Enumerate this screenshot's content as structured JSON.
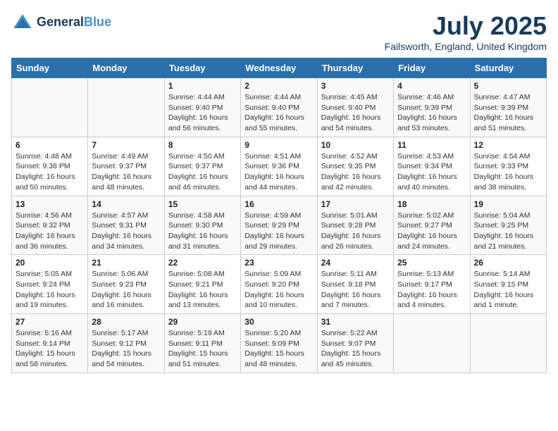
{
  "header": {
    "logo_line1": "General",
    "logo_line2": "Blue",
    "month": "July 2025",
    "location": "Failsworth, England, United Kingdom"
  },
  "days_of_week": [
    "Sunday",
    "Monday",
    "Tuesday",
    "Wednesday",
    "Thursday",
    "Friday",
    "Saturday"
  ],
  "weeks": [
    [
      {
        "day": "",
        "sunrise": "",
        "sunset": "",
        "daylight": ""
      },
      {
        "day": "",
        "sunrise": "",
        "sunset": "",
        "daylight": ""
      },
      {
        "day": "1",
        "sunrise": "Sunrise: 4:44 AM",
        "sunset": "Sunset: 9:40 PM",
        "daylight": "Daylight: 16 hours and 56 minutes."
      },
      {
        "day": "2",
        "sunrise": "Sunrise: 4:44 AM",
        "sunset": "Sunset: 9:40 PM",
        "daylight": "Daylight: 16 hours and 55 minutes."
      },
      {
        "day": "3",
        "sunrise": "Sunrise: 4:45 AM",
        "sunset": "Sunset: 9:40 PM",
        "daylight": "Daylight: 16 hours and 54 minutes."
      },
      {
        "day": "4",
        "sunrise": "Sunrise: 4:46 AM",
        "sunset": "Sunset: 9:39 PM",
        "daylight": "Daylight: 16 hours and 53 minutes."
      },
      {
        "day": "5",
        "sunrise": "Sunrise: 4:47 AM",
        "sunset": "Sunset: 9:39 PM",
        "daylight": "Daylight: 16 hours and 51 minutes."
      }
    ],
    [
      {
        "day": "6",
        "sunrise": "Sunrise: 4:48 AM",
        "sunset": "Sunset: 9:38 PM",
        "daylight": "Daylight: 16 hours and 50 minutes."
      },
      {
        "day": "7",
        "sunrise": "Sunrise: 4:49 AM",
        "sunset": "Sunset: 9:37 PM",
        "daylight": "Daylight: 16 hours and 48 minutes."
      },
      {
        "day": "8",
        "sunrise": "Sunrise: 4:50 AM",
        "sunset": "Sunset: 9:37 PM",
        "daylight": "Daylight: 16 hours and 46 minutes."
      },
      {
        "day": "9",
        "sunrise": "Sunrise: 4:51 AM",
        "sunset": "Sunset: 9:36 PM",
        "daylight": "Daylight: 16 hours and 44 minutes."
      },
      {
        "day": "10",
        "sunrise": "Sunrise: 4:52 AM",
        "sunset": "Sunset: 9:35 PM",
        "daylight": "Daylight: 16 hours and 42 minutes."
      },
      {
        "day": "11",
        "sunrise": "Sunrise: 4:53 AM",
        "sunset": "Sunset: 9:34 PM",
        "daylight": "Daylight: 16 hours and 40 minutes."
      },
      {
        "day": "12",
        "sunrise": "Sunrise: 4:54 AM",
        "sunset": "Sunset: 9:33 PM",
        "daylight": "Daylight: 16 hours and 38 minutes."
      }
    ],
    [
      {
        "day": "13",
        "sunrise": "Sunrise: 4:56 AM",
        "sunset": "Sunset: 9:32 PM",
        "daylight": "Daylight: 16 hours and 36 minutes."
      },
      {
        "day": "14",
        "sunrise": "Sunrise: 4:57 AM",
        "sunset": "Sunset: 9:31 PM",
        "daylight": "Daylight: 16 hours and 34 minutes."
      },
      {
        "day": "15",
        "sunrise": "Sunrise: 4:58 AM",
        "sunset": "Sunset: 9:30 PM",
        "daylight": "Daylight: 16 hours and 31 minutes."
      },
      {
        "day": "16",
        "sunrise": "Sunrise: 4:59 AM",
        "sunset": "Sunset: 9:29 PM",
        "daylight": "Daylight: 16 hours and 29 minutes."
      },
      {
        "day": "17",
        "sunrise": "Sunrise: 5:01 AM",
        "sunset": "Sunset: 9:28 PM",
        "daylight": "Daylight: 16 hours and 26 minutes."
      },
      {
        "day": "18",
        "sunrise": "Sunrise: 5:02 AM",
        "sunset": "Sunset: 9:27 PM",
        "daylight": "Daylight: 16 hours and 24 minutes."
      },
      {
        "day": "19",
        "sunrise": "Sunrise: 5:04 AM",
        "sunset": "Sunset: 9:25 PM",
        "daylight": "Daylight: 16 hours and 21 minutes."
      }
    ],
    [
      {
        "day": "20",
        "sunrise": "Sunrise: 5:05 AM",
        "sunset": "Sunset: 9:24 PM",
        "daylight": "Daylight: 16 hours and 19 minutes."
      },
      {
        "day": "21",
        "sunrise": "Sunrise: 5:06 AM",
        "sunset": "Sunset: 9:23 PM",
        "daylight": "Daylight: 16 hours and 16 minutes."
      },
      {
        "day": "22",
        "sunrise": "Sunrise: 5:08 AM",
        "sunset": "Sunset: 9:21 PM",
        "daylight": "Daylight: 16 hours and 13 minutes."
      },
      {
        "day": "23",
        "sunrise": "Sunrise: 5:09 AM",
        "sunset": "Sunset: 9:20 PM",
        "daylight": "Daylight: 16 hours and 10 minutes."
      },
      {
        "day": "24",
        "sunrise": "Sunrise: 5:11 AM",
        "sunset": "Sunset: 9:18 PM",
        "daylight": "Daylight: 16 hours and 7 minutes."
      },
      {
        "day": "25",
        "sunrise": "Sunrise: 5:13 AM",
        "sunset": "Sunset: 9:17 PM",
        "daylight": "Daylight: 16 hours and 4 minutes."
      },
      {
        "day": "26",
        "sunrise": "Sunrise: 5:14 AM",
        "sunset": "Sunset: 9:15 PM",
        "daylight": "Daylight: 16 hours and 1 minute."
      }
    ],
    [
      {
        "day": "27",
        "sunrise": "Sunrise: 5:16 AM",
        "sunset": "Sunset: 9:14 PM",
        "daylight": "Daylight: 15 hours and 58 minutes."
      },
      {
        "day": "28",
        "sunrise": "Sunrise: 5:17 AM",
        "sunset": "Sunset: 9:12 PM",
        "daylight": "Daylight: 15 hours and 54 minutes."
      },
      {
        "day": "29",
        "sunrise": "Sunrise: 5:19 AM",
        "sunset": "Sunset: 9:11 PM",
        "daylight": "Daylight: 15 hours and 51 minutes."
      },
      {
        "day": "30",
        "sunrise": "Sunrise: 5:20 AM",
        "sunset": "Sunset: 9:09 PM",
        "daylight": "Daylight: 15 hours and 48 minutes."
      },
      {
        "day": "31",
        "sunrise": "Sunrise: 5:22 AM",
        "sunset": "Sunset: 9:07 PM",
        "daylight": "Daylight: 15 hours and 45 minutes."
      },
      {
        "day": "",
        "sunrise": "",
        "sunset": "",
        "daylight": ""
      },
      {
        "day": "",
        "sunrise": "",
        "sunset": "",
        "daylight": ""
      }
    ]
  ]
}
